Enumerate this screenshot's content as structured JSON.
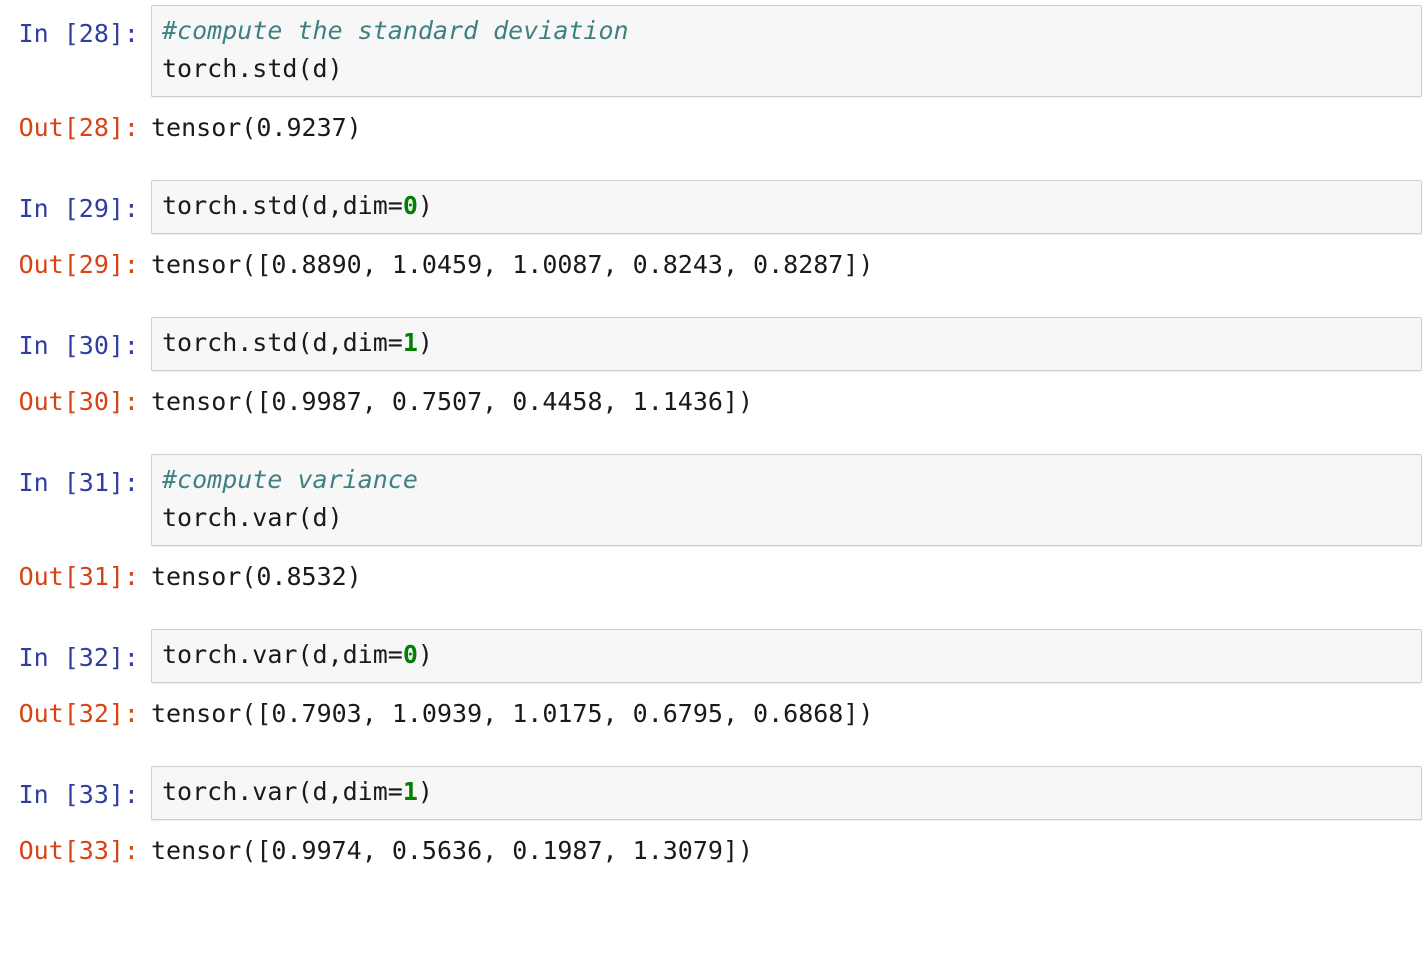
{
  "notebook": {
    "kernel_language": "python",
    "colors": {
      "in_prompt": "#303F9F",
      "out_prompt": "#D84315",
      "comment": "#408080",
      "number_literal": "#008000",
      "code_text": "#1a1a1a",
      "cell_background": "#f7f7f7",
      "cell_border": "#cfcfcf",
      "page_background": "#ffffff"
    },
    "cells": [
      {
        "in_prompt": "In [28]:",
        "out_prompt": "Out[28]:",
        "code_lines": [
          {
            "segments": [
              {
                "text": "#compute the standard deviation",
                "type": "comment"
              }
            ]
          },
          {
            "segments": [
              {
                "text": "torch.std(d)",
                "type": "plain"
              }
            ]
          }
        ],
        "output": "tensor(0.9237)"
      },
      {
        "in_prompt": "In [29]:",
        "out_prompt": "Out[29]:",
        "code_lines": [
          {
            "segments": [
              {
                "text": "torch.std(d,dim=",
                "type": "plain"
              },
              {
                "text": "0",
                "type": "number"
              },
              {
                "text": ")",
                "type": "plain"
              }
            ]
          }
        ],
        "output": "tensor([0.8890, 1.0459, 1.0087, 0.8243, 0.8287])"
      },
      {
        "in_prompt": "In [30]:",
        "out_prompt": "Out[30]:",
        "code_lines": [
          {
            "segments": [
              {
                "text": "torch.std(d,dim=",
                "type": "plain"
              },
              {
                "text": "1",
                "type": "number"
              },
              {
                "text": ")",
                "type": "plain"
              }
            ]
          }
        ],
        "output": "tensor([0.9987, 0.7507, 0.4458, 1.1436])"
      },
      {
        "in_prompt": "In [31]:",
        "out_prompt": "Out[31]:",
        "code_lines": [
          {
            "segments": [
              {
                "text": "#compute variance",
                "type": "comment"
              }
            ]
          },
          {
            "segments": [
              {
                "text": "torch.var(d)",
                "type": "plain"
              }
            ]
          }
        ],
        "output": "tensor(0.8532)"
      },
      {
        "in_prompt": "In [32]:",
        "out_prompt": "Out[32]:",
        "code_lines": [
          {
            "segments": [
              {
                "text": "torch.var(d,dim=",
                "type": "plain"
              },
              {
                "text": "0",
                "type": "number"
              },
              {
                "text": ")",
                "type": "plain"
              }
            ]
          }
        ],
        "output": "tensor([0.7903, 1.0939, 1.0175, 0.6795, 0.6868])"
      },
      {
        "in_prompt": "In [33]:",
        "out_prompt": "Out[33]:",
        "code_lines": [
          {
            "segments": [
              {
                "text": "torch.var(d,dim=",
                "type": "plain"
              },
              {
                "text": "1",
                "type": "number"
              },
              {
                "text": ")",
                "type": "plain"
              }
            ]
          }
        ],
        "output": "tensor([0.9974, 0.5636, 0.1987, 1.3079])"
      }
    ]
  }
}
